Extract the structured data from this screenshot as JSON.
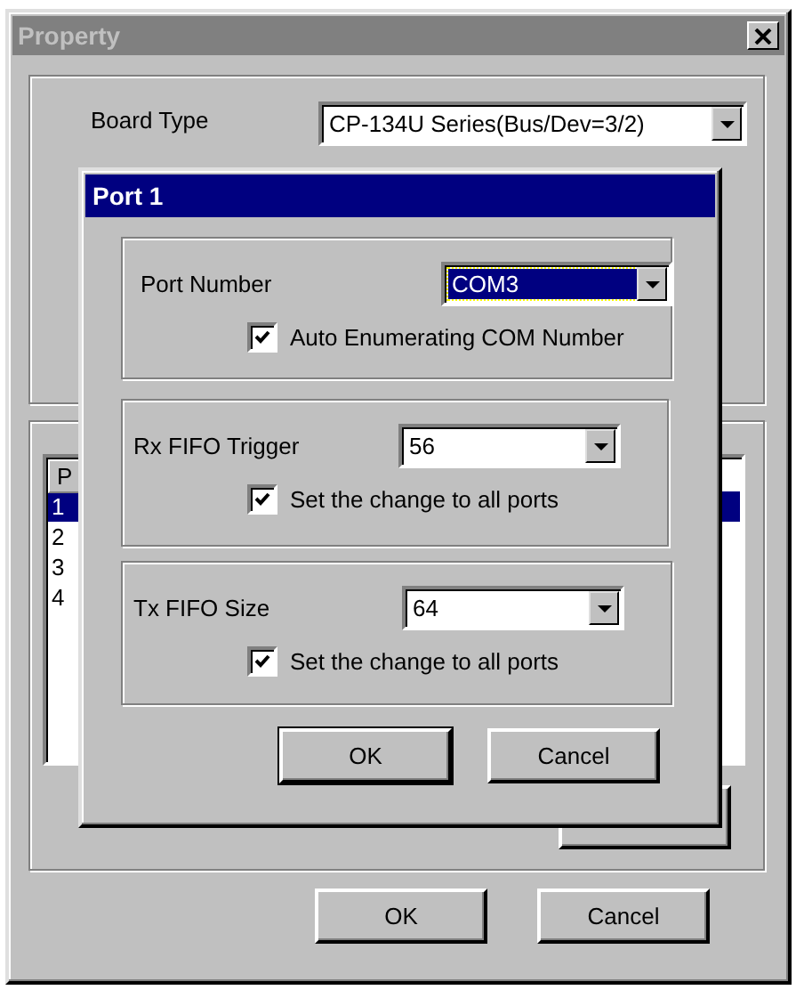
{
  "window": {
    "title": "Property",
    "active": false
  },
  "board_type": {
    "label": "Board Type",
    "value": "CP-134U Series(Bus/Dev=3/2)"
  },
  "port_list": {
    "columns": [
      "P"
    ],
    "rows": [
      {
        "cells": [
          "1"
        ],
        "selected": true
      },
      {
        "cells": [
          "2"
        ],
        "selected": false
      },
      {
        "cells": [
          "3"
        ],
        "selected": false
      },
      {
        "cells": [
          "4"
        ],
        "selected": false
      }
    ]
  },
  "buttons": [
    "OK",
    "Cancel"
  ],
  "dialog": {
    "title": "Port 1",
    "active": true,
    "groups": [
      {
        "label": "Port Number",
        "value": "COM3",
        "focused": true,
        "checkbox": {
          "label": "Auto Enumerating COM Number",
          "checked": true
        }
      },
      {
        "label": "Rx FIFO Trigger",
        "value": "56",
        "focused": false,
        "checkbox": {
          "label": "Set the change to all ports",
          "checked": true
        }
      },
      {
        "label": "Tx FIFO Size",
        "value": "64",
        "focused": false,
        "checkbox": {
          "label": "Set the change to all ports",
          "checked": true
        }
      }
    ],
    "buttons": [
      "OK",
      "Cancel"
    ]
  }
}
